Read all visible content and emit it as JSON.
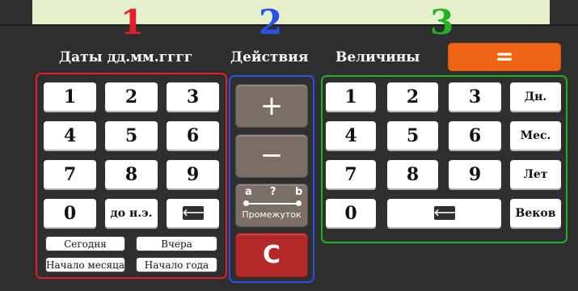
{
  "section_numbers": [
    "1",
    "2",
    "3"
  ],
  "headings": {
    "dates": "Даты дд.мм.гггг",
    "actions": "Действия",
    "values": "Величины"
  },
  "equals_label": "=",
  "colors": {
    "section1": "#e0202a",
    "section2": "#2a50e6",
    "section3": "#24b224",
    "equals": "#ef6414",
    "clear": "#b42828"
  },
  "dates_keypad": {
    "digits": [
      "1",
      "2",
      "3",
      "4",
      "5",
      "6",
      "7",
      "8",
      "9",
      "0"
    ],
    "era": "до н.э.",
    "backspace_icon": "backspace-icon",
    "backspace_glyph": "🡐",
    "today": "Сегодня",
    "yesterday": "Вчера",
    "month_start": "Начало месяца",
    "year_start": "Начало года"
  },
  "actions": {
    "plus": "+",
    "minus": "−",
    "interval_a": "a",
    "interval_q": "?",
    "interval_b": "b",
    "interval_label": "Промежуток",
    "clear": "C"
  },
  "values_keypad": {
    "digits": [
      "1",
      "2",
      "3",
      "4",
      "5",
      "6",
      "7",
      "8",
      "9",
      "0"
    ],
    "days": "Дн.",
    "months": "Мес.",
    "years": "Лет",
    "centuries": "Веков",
    "backspace_glyph": "🡐"
  }
}
